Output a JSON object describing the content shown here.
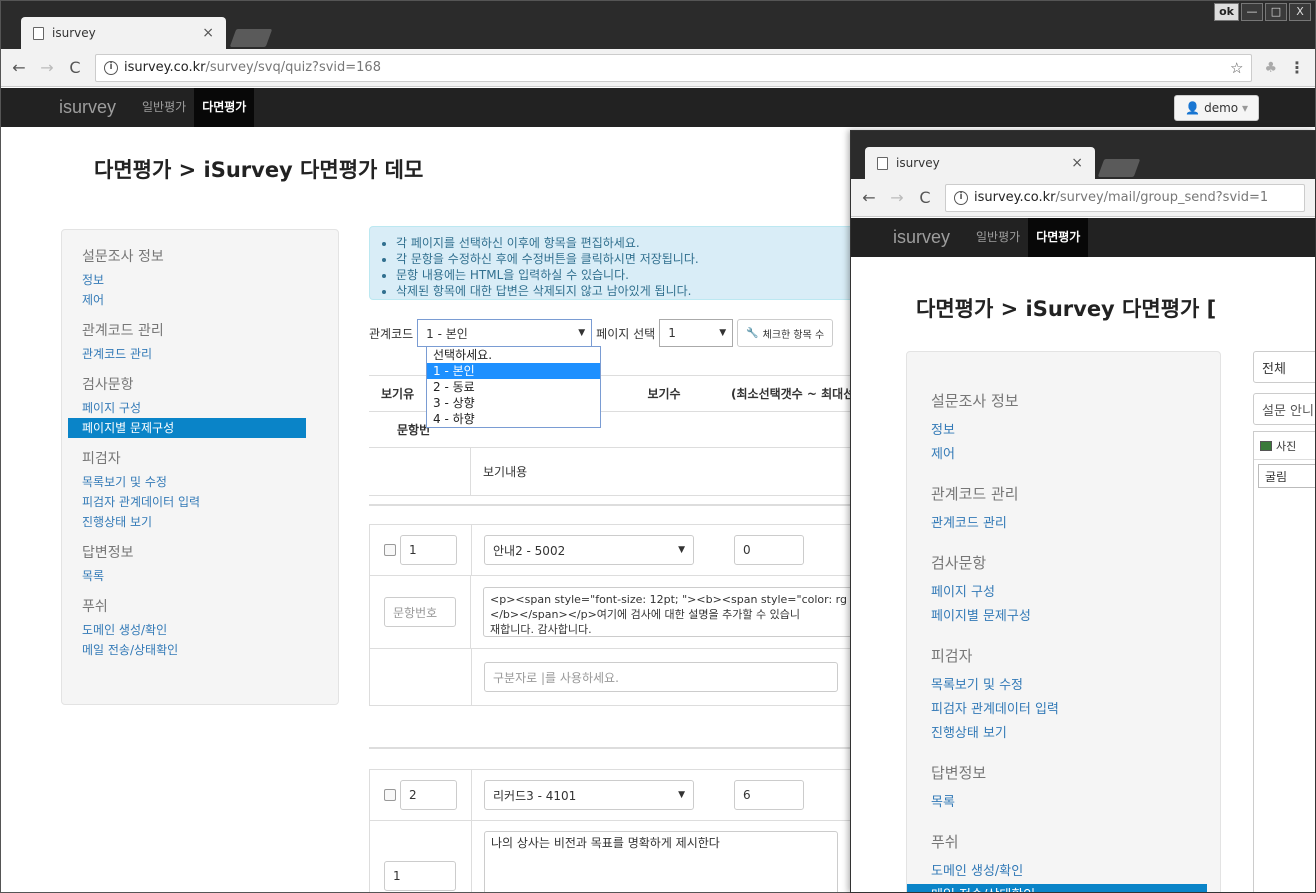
{
  "window1": {
    "tab_title": "isurvey",
    "window_buttons": [
      "ok",
      "—",
      "□",
      "X"
    ],
    "url_domain": "isurvey.co.kr",
    "url_path": "/survey/svq/quiz?svid=168",
    "brand": "isurvey",
    "nav": [
      "일반평가",
      "다면평가"
    ],
    "user": "demo",
    "page_title": "다면평가 > iSurvey 다면평가 데모",
    "sidebar": [
      {
        "head": "설문조사 정보",
        "links": [
          "정보",
          "제어"
        ]
      },
      {
        "head": "관계코드 관리",
        "links": [
          "관계코드 관리"
        ]
      },
      {
        "head": "검사문항",
        "links": [
          "페이지 구성",
          "페이지별 문제구성"
        ]
      },
      {
        "head": "피검자",
        "links": [
          "목록보기 및 수정",
          "피검자 관계데이터 입력",
          "진행상태 보기"
        ]
      },
      {
        "head": "답변정보",
        "links": [
          "목록"
        ]
      },
      {
        "head": "푸쉬",
        "links": [
          "도메인 생성/확인",
          "메일 전송/상태확인"
        ]
      }
    ],
    "alert": [
      "각 페이지를 선택하신 이후에 항목을 편집하세요.",
      "각 문항을 수정하신 후에 수정버튼을 클릭하시면 저장됩니다.",
      "문항 내용에는 HTML을 입력하실 수 있습니다.",
      "삭제된 항목에 대한 답변은 삭제되지 않고 남아있게 됩니다."
    ],
    "toolbar": {
      "code_label": "관계코드",
      "code_value": "1 - 본인",
      "page_label": "페이지 선택",
      "page_value": "1",
      "checked_btn": "체크한 항목 수"
    },
    "dropdown_options": [
      "선택하세요.",
      "1 - 본인",
      "2 - 동료",
      "3 - 상향",
      "4 - 하향"
    ],
    "table_headers": {
      "c1": "보기유",
      "c3": "보기수",
      "c4": "(최소선택갯수 ~ 최대선",
      "r2": "문항번",
      "r3": "보기내용"
    },
    "q1": {
      "num": "1",
      "type": "안내2 - 5002",
      "count": "0",
      "numph": "문항번호",
      "content_l1": "<p><span style=\"font-size: 12pt; \"><b><span style=\"color: rg",
      "content_l2": "</b></span></p>여기에 검사에 대한 설명을 추가할 수 있습니",
      "content_l3": "재합니다. 감사합니다.",
      "options_ph": "구분자로 |를 사용하세요."
    },
    "q2": {
      "num": "2",
      "type": "리커드3 - 4101",
      "count": "6",
      "qnum": "1",
      "content": "나의 상사는 비전과 목표를 명확하게 제시한다"
    }
  },
  "window2": {
    "tab_title": "isurvey",
    "url_domain": "isurvey.co.kr",
    "url_path": "/survey/mail/group_send?svid=1",
    "brand": "isurvey",
    "nav": [
      "일반평가",
      "다면평가"
    ],
    "page_title": "다면평가 > iSurvey 다면평가 [",
    "filter_value": "전체",
    "subject_value": "설문 안니",
    "photo_btn": "사진",
    "font_value": "굴림"
  }
}
